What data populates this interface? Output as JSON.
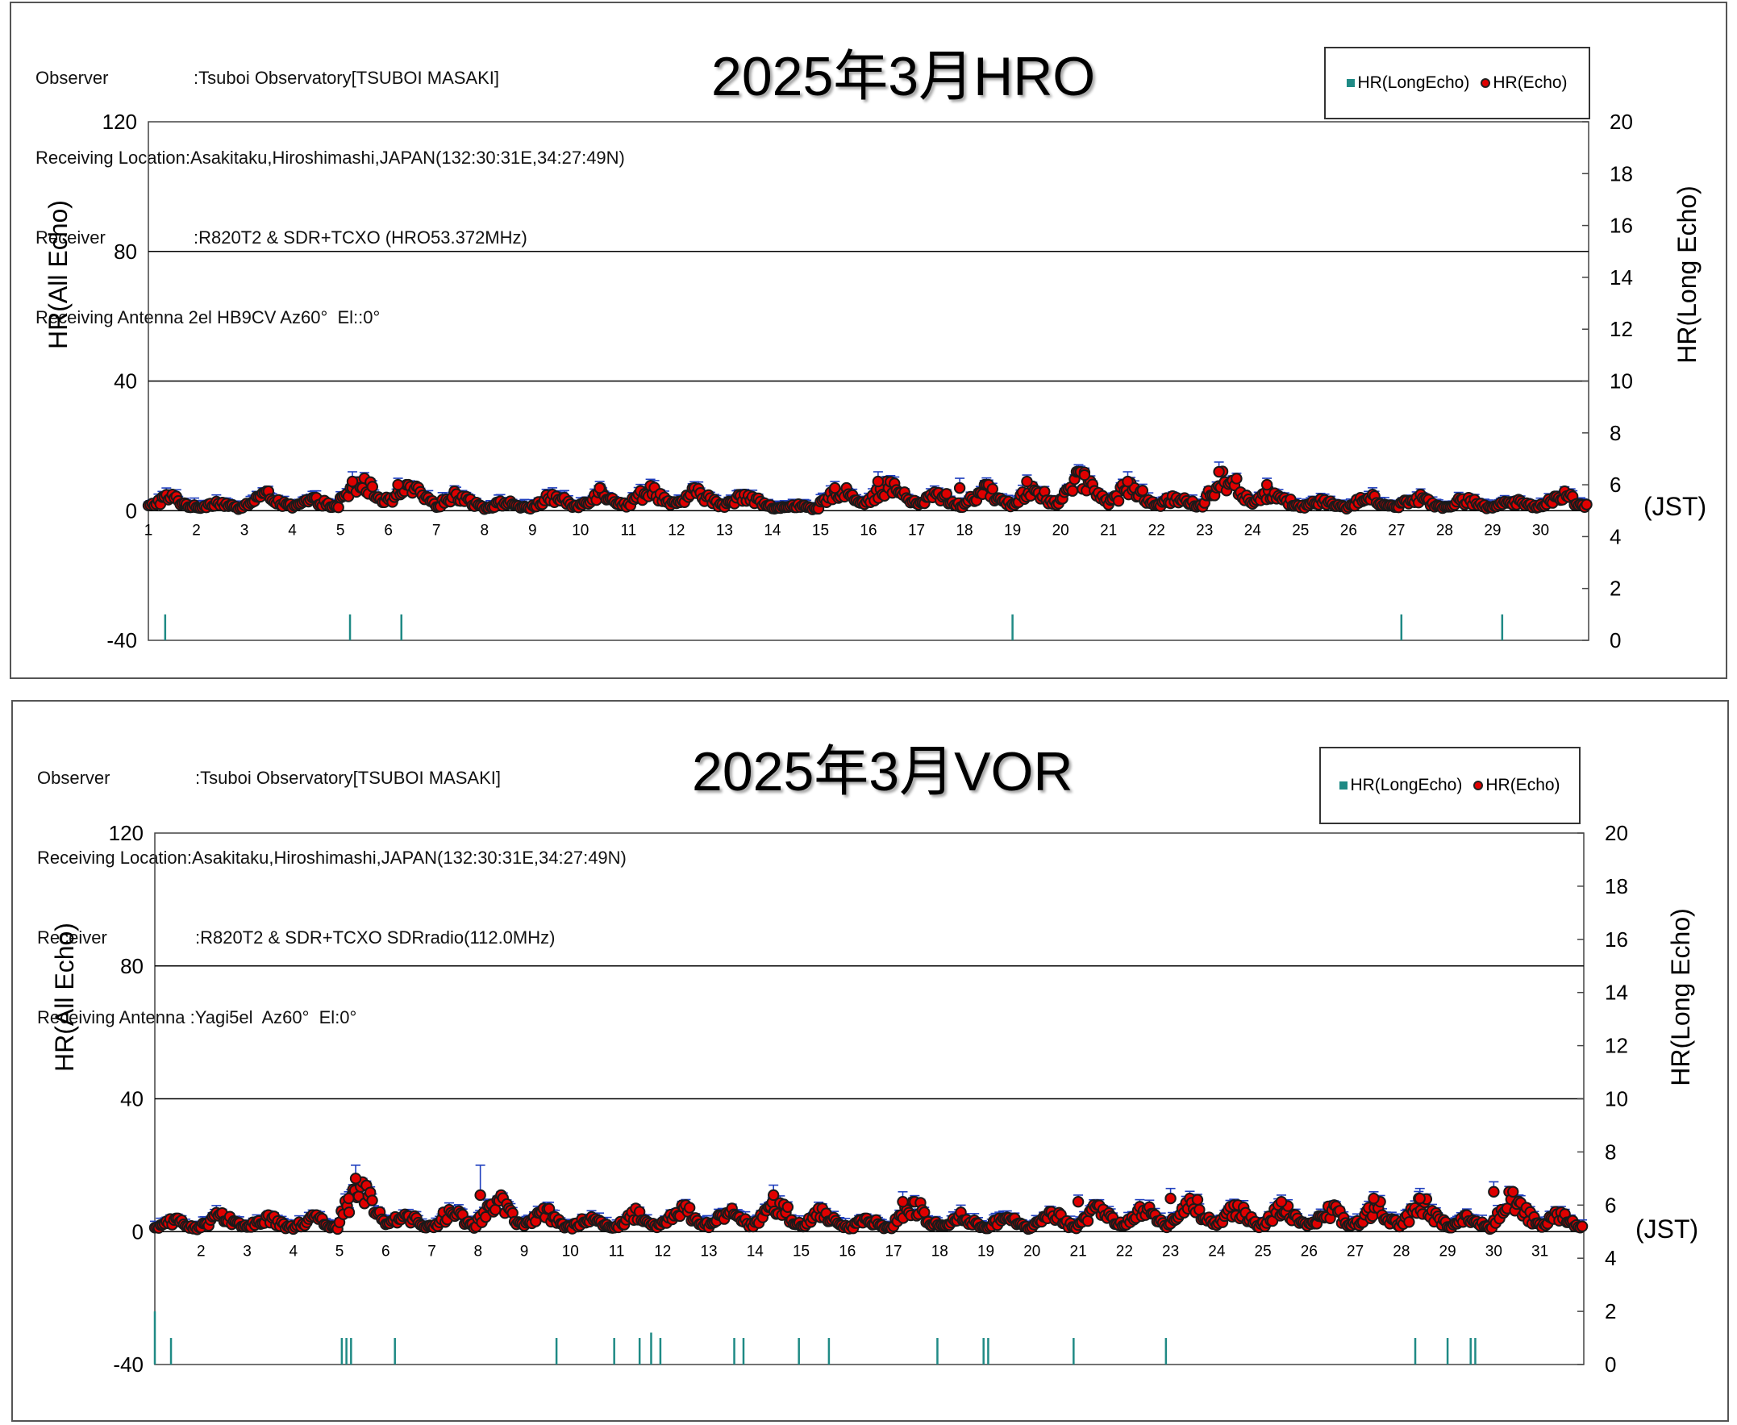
{
  "colors": {
    "echo_fill": "#e00000",
    "echo_edge": "#1a1a1a",
    "errbar": "#1f3fbf",
    "long_echo": "#1f8a85",
    "grid": "#000000"
  },
  "panels": [
    {
      "meta": [
        [
          "Observer",
          ":Tsuboi Observatory[TSUBOI MASAKI]"
        ],
        [
          "Receiving Location",
          ":Asakitaku,Hiroshimashi,JAPAN(132:30:31E,34:27:49N)"
        ],
        [
          "Receiver",
          ":R820T2 & SDR+TCXO (HRO53.372MHz)"
        ],
        [
          "Receiving Antenna",
          " 2el HB9CV Az60°  El::0°"
        ]
      ],
      "title": "2025年3月HRO",
      "legend": {
        "long": "HR(LongEcho)",
        "echo": "HR(Echo)"
      },
      "ylabel_left": "HR(All Echo)",
      "ylabel_right": "HR(Long Echo)",
      "x_unit": "(JST)"
    },
    {
      "meta": [
        [
          "Observer",
          ":Tsuboi Observatory[TSUBOI MASAKI]"
        ],
        [
          "Receiving Location",
          ":Asakitaku,Hiroshimashi,JAPAN(132:30:31E,34:27:49N)"
        ],
        [
          "Receiver",
          ":R820T2 & SDR+TCXO SDRradio(112.0MHz)"
        ],
        [
          "Receiving Antenna",
          " :Yagi5el  Az60°  El:0°"
        ]
      ],
      "title": "2025年3月VOR",
      "legend": {
        "long": "HR(LongEcho)",
        "echo": "HR(Echo)"
      },
      "ylabel_left": "HR(All Echo)",
      "ylabel_right": "HR(Long Echo)",
      "x_unit": "(JST)"
    }
  ],
  "chart_data": [
    {
      "type": "scatter",
      "title": "2025年3月HRO",
      "xlim": [
        1,
        31
      ],
      "x_ticks": [
        1,
        2,
        3,
        4,
        5,
        6,
        7,
        8,
        9,
        10,
        11,
        12,
        13,
        14,
        15,
        16,
        17,
        18,
        19,
        20,
        21,
        22,
        23,
        24,
        25,
        26,
        27,
        28,
        29,
        30
      ],
      "ylim_left": [
        -40,
        120
      ],
      "yticks_left": [
        -40,
        0,
        40,
        80,
        120
      ],
      "ylim_right": [
        0,
        20
      ],
      "yticks_right": [
        0,
        2,
        4,
        6,
        8,
        10,
        12,
        14,
        16,
        18,
        20
      ],
      "grid": "horizontal major",
      "ylabel_left": "HR(All Echo)",
      "ylabel_right": "HR(Long Echo)",
      "legend": "top-right",
      "series": [
        {
          "name": "HR(Echo)",
          "axis": "left",
          "sampling": "hourly",
          "daily_range": [
            [
              0,
              5
            ],
            [
              0,
              3
            ],
            [
              0,
              6
            ],
            [
              0,
              4
            ],
            [
              1,
              10
            ],
            [
              1,
              8
            ],
            [
              0,
              6
            ],
            [
              0,
              3
            ],
            [
              0,
              5
            ],
            [
              0,
              7
            ],
            [
              0,
              8
            ],
            [
              0,
              7
            ],
            [
              0,
              6
            ],
            [
              0,
              2
            ],
            [
              1,
              7
            ],
            [
              1,
              9
            ],
            [
              0,
              6
            ],
            [
              0,
              8
            ],
            [
              0,
              8
            ],
            [
              1,
              12
            ],
            [
              0,
              9
            ],
            [
              0,
              5
            ],
            [
              0,
              13
            ],
            [
              0,
              7
            ],
            [
              0,
              4
            ],
            [
              0,
              5
            ],
            [
              0,
              5
            ],
            [
              0,
              4
            ],
            [
              0,
              4
            ],
            [
              0,
              6
            ]
          ],
          "peaks": [
            {
              "x": 5.25,
              "y": 9,
              "err": 3
            },
            {
              "x": 6.2,
              "y": 8,
              "err": 2
            },
            {
              "x": 10.4,
              "y": 7,
              "err": 2
            },
            {
              "x": 15.3,
              "y": 7,
              "err": 2
            },
            {
              "x": 16.2,
              "y": 9,
              "err": 3
            },
            {
              "x": 17.9,
              "y": 7,
              "err": 3
            },
            {
              "x": 19.3,
              "y": 9,
              "err": 2
            },
            {
              "x": 20.5,
              "y": 11,
              "err": 2
            },
            {
              "x": 21.4,
              "y": 9,
              "err": 3
            },
            {
              "x": 23.3,
              "y": 12,
              "err": 3
            },
            {
              "x": 24.3,
              "y": 8,
              "err": 2
            }
          ]
        },
        {
          "name": "HR(LongEcho)",
          "axis": "right",
          "points": [
            {
              "x": 1.35,
              "y": 1
            },
            {
              "x": 5.2,
              "y": 1
            },
            {
              "x": 6.27,
              "y": 1
            },
            {
              "x": 19.0,
              "y": 1
            },
            {
              "x": 27.1,
              "y": 1
            },
            {
              "x": 29.2,
              "y": 1
            }
          ]
        }
      ]
    },
    {
      "type": "scatter",
      "title": "2025年3月VOR",
      "xlim": [
        1,
        31.95
      ],
      "x_ticks": [
        2,
        3,
        4,
        5,
        6,
        7,
        8,
        9,
        10,
        11,
        12,
        13,
        14,
        15,
        16,
        17,
        18,
        19,
        20,
        21,
        22,
        23,
        24,
        25,
        26,
        27,
        28,
        29,
        30,
        31
      ],
      "ylim_left": [
        -40,
        120
      ],
      "yticks_left": [
        -40,
        0,
        40,
        80,
        120
      ],
      "ylim_right": [
        0,
        20
      ],
      "yticks_right": [
        0,
        2,
        4,
        6,
        8,
        10,
        12,
        14,
        16,
        18,
        20
      ],
      "grid": "horizontal major",
      "ylabel_left": "HR(All Echo)",
      "ylabel_right": "HR(Long Echo)",
      "legend": "top-right",
      "series": [
        {
          "name": "HR(Echo)",
          "axis": "left",
          "sampling": "hourly",
          "daily_range": [
            [
              0,
              4
            ],
            [
              0,
              6
            ],
            [
              0,
              5
            ],
            [
              0,
              5
            ],
            [
              0,
              16
            ],
            [
              0,
              6
            ],
            [
              0,
              7
            ],
            [
              0,
              11
            ],
            [
              0,
              7
            ],
            [
              0,
              5
            ],
            [
              0,
              7
            ],
            [
              0,
              8
            ],
            [
              0,
              8
            ],
            [
              0,
              11
            ],
            [
              0,
              7
            ],
            [
              0,
              4
            ],
            [
              0,
              9
            ],
            [
              0,
              6
            ],
            [
              0,
              5
            ],
            [
              0,
              6
            ],
            [
              0,
              8
            ],
            [
              0,
              8
            ],
            [
              0,
              10
            ],
            [
              0,
              8
            ],
            [
              0,
              8
            ],
            [
              0,
              8
            ],
            [
              0,
              9
            ],
            [
              0,
              10
            ],
            [
              0,
              5
            ],
            [
              0,
              12
            ],
            [
              0,
              6
            ]
          ],
          "peaks": [
            {
              "x": 5.35,
              "y": 16,
              "err": 4
            },
            {
              "x": 5.2,
              "y": 10,
              "err": 2
            },
            {
              "x": 8.05,
              "y": 11,
              "err": 9
            },
            {
              "x": 14.4,
              "y": 11,
              "err": 3
            },
            {
              "x": 17.2,
              "y": 9,
              "err": 3
            },
            {
              "x": 21.0,
              "y": 9,
              "err": 2
            },
            {
              "x": 23.0,
              "y": 10,
              "err": 3
            },
            {
              "x": 25.4,
              "y": 9,
              "err": 2
            },
            {
              "x": 27.4,
              "y": 10,
              "err": 2
            },
            {
              "x": 28.4,
              "y": 10,
              "err": 3
            },
            {
              "x": 30.0,
              "y": 12,
              "err": 3
            }
          ]
        },
        {
          "name": "HR(LongEcho)",
          "axis": "right",
          "points": [
            {
              "x": 1.0,
              "y": 2
            },
            {
              "x": 1.35,
              "y": 1
            },
            {
              "x": 5.05,
              "y": 1
            },
            {
              "x": 5.15,
              "y": 1
            },
            {
              "x": 5.25,
              "y": 1
            },
            {
              "x": 6.2,
              "y": 1
            },
            {
              "x": 9.7,
              "y": 1
            },
            {
              "x": 10.95,
              "y": 1
            },
            {
              "x": 11.5,
              "y": 1
            },
            {
              "x": 11.75,
              "y": 1.2
            },
            {
              "x": 11.95,
              "y": 1
            },
            {
              "x": 13.55,
              "y": 1
            },
            {
              "x": 13.75,
              "y": 1
            },
            {
              "x": 14.95,
              "y": 1
            },
            {
              "x": 15.6,
              "y": 1
            },
            {
              "x": 17.95,
              "y": 1
            },
            {
              "x": 18.95,
              "y": 1
            },
            {
              "x": 19.05,
              "y": 1
            },
            {
              "x": 20.9,
              "y": 1
            },
            {
              "x": 22.9,
              "y": 1
            },
            {
              "x": 28.3,
              "y": 1
            },
            {
              "x": 29.0,
              "y": 1
            },
            {
              "x": 29.5,
              "y": 1
            },
            {
              "x": 29.6,
              "y": 1
            }
          ]
        }
      ]
    }
  ]
}
